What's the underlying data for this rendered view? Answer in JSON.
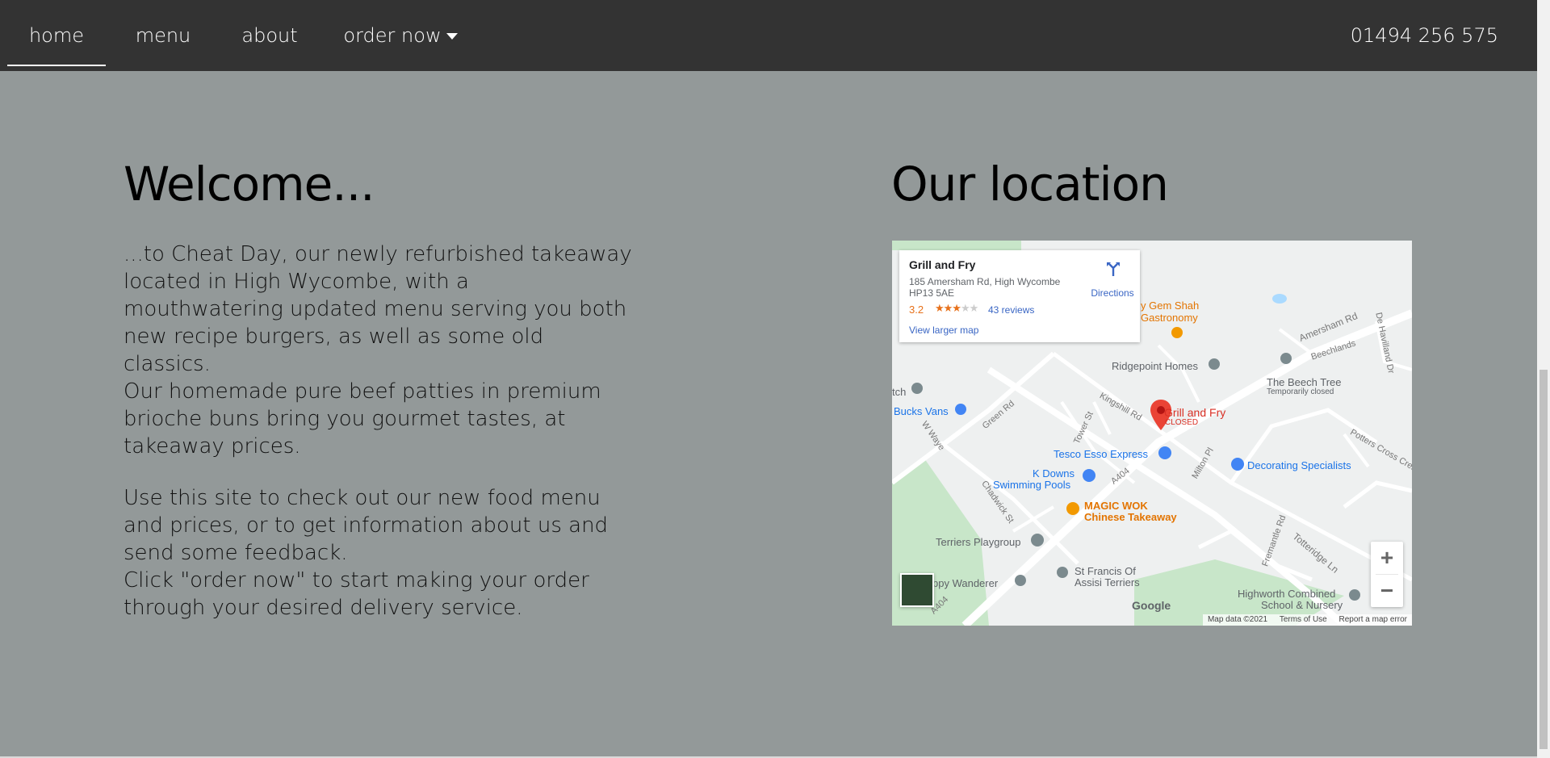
{
  "nav": {
    "items": [
      {
        "label": "home"
      },
      {
        "label": "menu"
      },
      {
        "label": "about"
      },
      {
        "label": "order now"
      }
    ],
    "phone": "01494 256 575"
  },
  "welcome": {
    "title": "Welcome...",
    "p1_lines": [
      "...to Cheat Day, our newly refurbished takeaway",
      "located in High Wycombe, with a",
      "mouthwatering updated menu serving you both",
      "new recipe burgers, as well as some old",
      "classics.",
      "Our homemade pure beef patties in premium",
      "brioche buns bring you gourmet tastes, at",
      "takeaway prices."
    ],
    "p2_lines": [
      "Use this site to check out our new food menu",
      "and prices, or to get information about us and",
      "send some feedback.",
      "Click \"order now\" to start making your order",
      "through your desired delivery service."
    ]
  },
  "location": {
    "title": "Our location",
    "map": {
      "place_name": "Grill and Fry",
      "address_line1": "185 Amersham Rd, High Wycombe",
      "address_line2": "HP13 5AE",
      "rating": "3.2",
      "reviews": "43 reviews",
      "larger_map": "View larger map",
      "directions": "Directions",
      "marker_name": "Grill and Fry",
      "marker_status": "CLOSED",
      "labels": {
        "gem_shah": "y Gem Shah",
        "gastronomy": "Gastronomy",
        "ridgepoint": "Ridgepoint Homes",
        "beech_tree": "The Beech Tree",
        "beech_status": "Temporarily closed",
        "beechlands": "Beechlands",
        "amersham_rd": "Amersham Rd",
        "de_havilland": "De Havilland Dr",
        "tch": "tch",
        "bucks_vans": "Bucks Vans",
        "green_rd": "Green Rd",
        "kingshill": "Kingshill Rd",
        "tower_st": "Tower St",
        "w_way": "W Waye",
        "tesco": "Tesco Esso Express",
        "decorating": "Decorating Specialists",
        "potters": "Potters Cross Cres",
        "milton": "Milton Pl",
        "k_downs1": "K Downs",
        "k_downs2": "Swimming Pools",
        "a404_top": "A404",
        "magic_wok1": "MAGIC WOK",
        "magic_wok2": "Chinese Takeaway",
        "chadwick": "Chadwick St",
        "terriers": "Terriers Playgroup",
        "fremantle": "Fremantle Rd",
        "totteridge": "Totteridge Ln",
        "happy_wanderer": "ppy Wanderer",
        "st_francis1": "St Francis Of",
        "st_francis2": "Assisi Terriers",
        "a404_bottom": "A404",
        "highworth1": "Highworth Combined",
        "highworth2": "School & Nursery",
        "google": "Google"
      },
      "attribution": {
        "data": "Map data ©2021",
        "terms": "Terms of Use",
        "report": "Report a map error"
      },
      "zoom_in": "+",
      "zoom_out": "−"
    }
  },
  "colors": {
    "navbar": "#333333",
    "background": "#939999",
    "link_blue": "#3a66c4",
    "rating_orange": "#e7711b",
    "marker_red": "#ea4335"
  }
}
